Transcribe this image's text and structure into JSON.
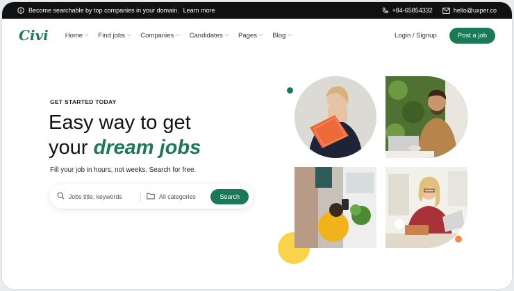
{
  "topbar": {
    "announcement": "Become searchable by top companies in your domain.",
    "learn_more": "Learn more",
    "phone": "+84-65854332",
    "email": "hello@uxper.co"
  },
  "nav": {
    "logo": "Civi",
    "items": [
      {
        "label": "Home"
      },
      {
        "label": "Find jobs"
      },
      {
        "label": "Companies"
      },
      {
        "label": "Candidates"
      },
      {
        "label": "Pages"
      },
      {
        "label": "Blog"
      }
    ],
    "login": "Login / Signup",
    "post_job": "Post a job"
  },
  "hero": {
    "eyebrow": "GET STARTED TODAY",
    "title_line1": "Easy way to get",
    "title_line2_prefix": "your ",
    "title_accent": "dream jobs",
    "subtitle": "Fill your job in hours, not weeks. Search for free."
  },
  "search": {
    "keyword_placeholder": "Jobs title, keywords",
    "category_placeholder": "All categories",
    "button": "Search"
  },
  "colors": {
    "accent": "#1a7a55",
    "topbar": "#111111",
    "highlight_yellow": "#f9d44a",
    "highlight_orange": "#f58a3c"
  }
}
